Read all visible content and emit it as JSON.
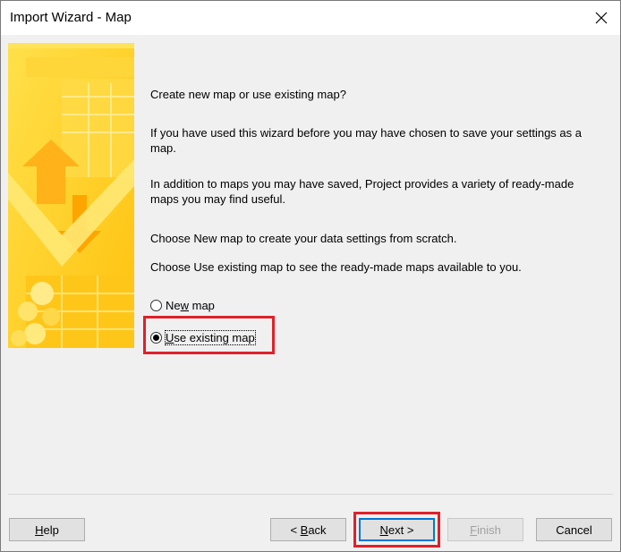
{
  "window": {
    "title": "Import Wizard - Map"
  },
  "content": {
    "heading": "Create new map or use existing map?",
    "para1": "If you have used this wizard before you may have chosen to save your settings as a map.",
    "para2": "In addition to maps you may have saved, Project provides a variety of ready-made maps you may find useful.",
    "para3": "Choose New map to create your data settings from scratch.",
    "para4": "Choose Use existing map to see the ready-made maps available to you."
  },
  "options": {
    "new_map": {
      "pre": "Ne",
      "accel": "w",
      "post": " map",
      "selected": false
    },
    "use_existing": {
      "pre": "",
      "accel": "U",
      "post": "se existing map",
      "selected": true
    }
  },
  "buttons": {
    "help": {
      "pre": "",
      "accel": "H",
      "post": "elp"
    },
    "back": {
      "pre": "< ",
      "accel": "B",
      "post": "ack"
    },
    "next": {
      "pre": "",
      "accel": "N",
      "post": "ext >"
    },
    "finish": {
      "pre": "",
      "accel": "F",
      "post": "inish",
      "enabled": false
    },
    "cancel": {
      "label": "Cancel"
    }
  },
  "colors": {
    "highlight": "#e0202a",
    "banner_yellow": "#ffd21f",
    "focus_blue": "#0078d7"
  },
  "icons": {
    "close": "close-icon",
    "banner": "wizard-banner-graphic"
  }
}
